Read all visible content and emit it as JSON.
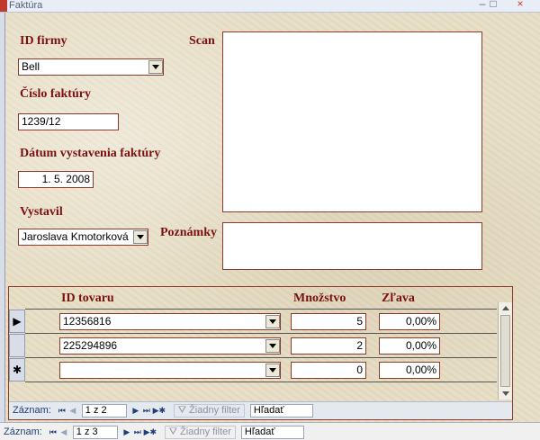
{
  "window": {
    "title": "Faktúra",
    "minimize": "–",
    "maximize": "□",
    "close": "×"
  },
  "labels": {
    "id_firmy": "ID firmy",
    "cislo_faktury": "Číslo faktúry",
    "datum": "Dátum vystavenia faktúry",
    "vystavil": "Vystavil",
    "scan": "Scan",
    "poznamky": "Poznámky"
  },
  "fields": {
    "id_firmy": "Bell",
    "cislo_faktury": "1239/12",
    "datum": "1. 5. 2008",
    "vystavil": "Jaroslava Kmotorková",
    "poznamky": ""
  },
  "subform": {
    "headers": {
      "id_tovaru": "ID tovaru",
      "mnozstvo": "Množstvo",
      "zlava": "Zľava"
    },
    "rows": [
      {
        "selector": "▶",
        "id_tovaru": "12356816",
        "mnozstvo": "5",
        "zlava": "0,00%"
      },
      {
        "selector": "",
        "id_tovaru": "225294896",
        "mnozstvo": "2",
        "zlava": "0,00%"
      },
      {
        "selector": "✱",
        "id_tovaru": "",
        "mnozstvo": "0",
        "zlava": "0,00%"
      }
    ],
    "nav": {
      "label": "Záznam:",
      "record": "1 z 2",
      "filter": "Žiadny filter",
      "search": "Hľadať"
    }
  },
  "mainnav": {
    "label": "Záznam:",
    "record": "1 z 3",
    "filter": "Žiadny filter",
    "search": "Hľadať"
  },
  "nav_buttons": {
    "first": "⏮",
    "prev": "◀",
    "next": "▶",
    "last": "⏭",
    "new": "▶✱"
  },
  "colors": {
    "label": "#7a1010",
    "border": "#8b3a2a",
    "background": "#e6ddc4",
    "nav_text": "#1e3e78"
  }
}
